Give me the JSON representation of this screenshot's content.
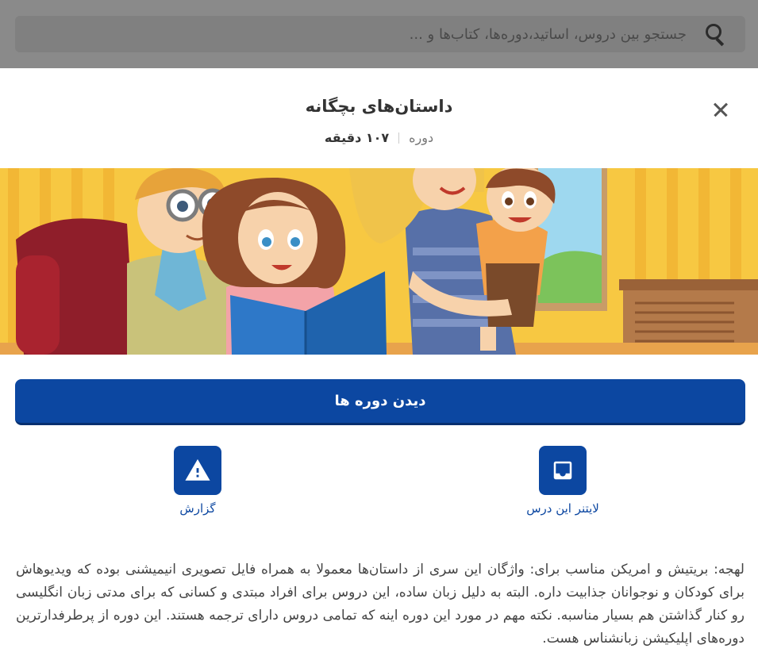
{
  "search": {
    "placeholder": "جستجو بین دروس، اساتید،دوره‌ها، کتاب‌ها و ..."
  },
  "header": {
    "title": "داستان‌های بچگانه",
    "type_label": "دوره",
    "duration": "۱۰۷ دقیقه"
  },
  "primary_button": {
    "label": "دیدن دوره ها"
  },
  "actions": {
    "leitner_label": "لایتنر این درس",
    "report_label": "گزارش"
  },
  "description": "لهجه: بریتیش و امریکن مناسب برای: واژگان این سری از داستان‌ها معمولا به همراه فایل تصویری انیمیشنی بوده که ویدیوهاش برای کودکان و نوجوانان جذابیت داره. البته به دلیل زبان ساده، این دروس برای افراد مبتدی و کسانی که برای مدتی زبان انگلیسی رو کنار گذاشتن هم بسیار مناسبه. نکته مهم در مورد این دوره اینه که تمامی دروس دارای ترجمه هستند. این دوره از پرطرفدارترین دوره‌های اپلیکیشن زبانشناس هست.",
  "colors": {
    "primary": "#0c47a1",
    "overlay": "#8a8a8a"
  },
  "icons": [
    "search-icon",
    "close-icon",
    "inbox-icon",
    "warning-icon"
  ]
}
